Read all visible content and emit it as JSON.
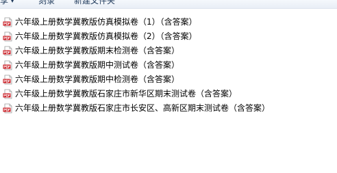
{
  "toolbar": {
    "share_label": "享",
    "burn_label": "刻录",
    "new_folder_label": "新建文件夹"
  },
  "icons": {
    "file_icon": "pdf-file-icon",
    "pdf_red": "#c8161d"
  },
  "files": [
    {
      "name": "六年级上册数学冀教版仿真模拟卷（1）（含答案）"
    },
    {
      "name": "六年级上册数学冀教版仿真模拟卷（2）（含答案）"
    },
    {
      "name": "六年级上册数学冀教版期末检测卷（含答案）"
    },
    {
      "name": "六年级上册数学冀教版期中测试卷（含答案）"
    },
    {
      "name": "六年级上册数学冀教版期中检测卷（含答案）"
    },
    {
      "name": "六年级上册数学冀教版石家庄市新华区期末测试卷（含答案）"
    },
    {
      "name": "六年级上册数学冀教版石家庄市长安区、高新区期末测试卷（含答案）"
    }
  ]
}
